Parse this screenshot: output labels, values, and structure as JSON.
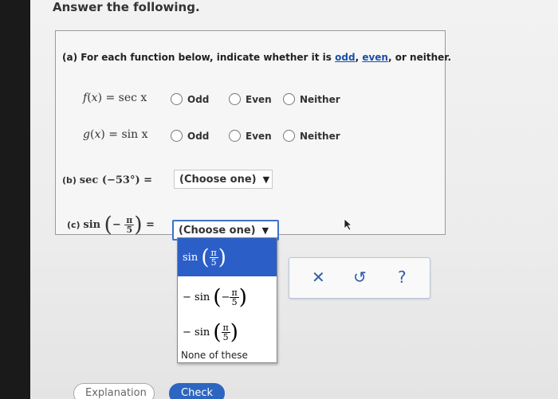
{
  "title": "Answer the following.",
  "part_a": {
    "prefix": "(a) For each function below, indicate whether it is",
    "link_odd": "odd",
    "comma1": ",",
    "link_even": "even",
    "suffix": ", or neither.",
    "rows": [
      {
        "f_name": "f",
        "var": "x",
        "expr": "sec x",
        "opt1": "Odd",
        "opt2": "Even",
        "opt3": "Neither"
      },
      {
        "f_name": "g",
        "var": "x",
        "expr": "sin x",
        "opt1": "Odd",
        "opt2": "Even",
        "opt3": "Neither"
      }
    ]
  },
  "part_b": {
    "label": "(b)",
    "func": "sec",
    "arg": "−53°",
    "equals": "=",
    "select_value": "(Choose one)"
  },
  "part_c": {
    "label": "(c)",
    "func": "sin",
    "minus": "−",
    "num": "π",
    "den": "5",
    "equals": "=",
    "select_value": "(Choose one)"
  },
  "dropdown": {
    "options": [
      {
        "prefix": "",
        "func": "sin",
        "minus": "",
        "num": "π",
        "den": "5"
      },
      {
        "prefix": "−",
        "func": "sin",
        "minus": "−",
        "num": "π",
        "den": "5"
      },
      {
        "prefix": "−",
        "func": "sin",
        "minus": "",
        "num": "π",
        "den": "5"
      }
    ],
    "none_label": "None of these"
  },
  "toolbar": {
    "clear": "✕",
    "undo": "↺",
    "help": "?"
  },
  "buttons": {
    "explanation": "Explanation",
    "check": "Check"
  }
}
